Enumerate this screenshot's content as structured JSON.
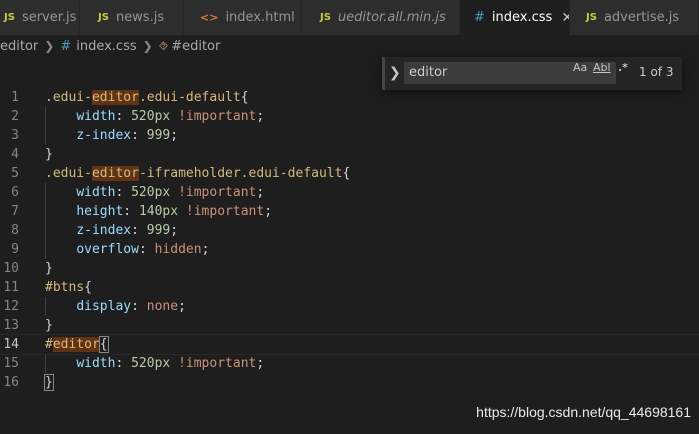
{
  "tabs": [
    {
      "icon": "JS",
      "label": "server.js",
      "type": "js"
    },
    {
      "icon": "JS",
      "label": "news.js",
      "type": "js"
    },
    {
      "icon": "<>",
      "label": "index.html",
      "type": "html"
    },
    {
      "icon": "JS",
      "label": "ueditor.all.min.js",
      "type": "js"
    },
    {
      "icon": "#",
      "label": "index.css",
      "type": "css",
      "close": "✕"
    },
    {
      "icon": "JS",
      "label": "advertise.js",
      "type": "js"
    }
  ],
  "breadcrumb": {
    "folder": "editor",
    "file": "index.css",
    "symbol": "#editor"
  },
  "find": {
    "query": "editor",
    "match_case": "Aa",
    "whole_word": "Abl",
    "regex": ".*",
    "result": "1 of 3"
  },
  "code_lines": [
    {
      "n": "1",
      "parts": [
        [
          ".edui-",
          "sel"
        ],
        [
          "editor",
          "selhl"
        ],
        [
          ".edui-default",
          "sel"
        ],
        [
          "{",
          "pun"
        ]
      ]
    },
    {
      "n": "2",
      "parts": [
        [
          "    ",
          "pun"
        ],
        [
          "width",
          "prop"
        ],
        [
          ": ",
          "pun"
        ],
        [
          "520px",
          "num"
        ],
        [
          " ",
          "pun"
        ],
        [
          "!important",
          "val"
        ],
        [
          ";",
          "pun"
        ]
      ]
    },
    {
      "n": "3",
      "parts": [
        [
          "    ",
          "pun"
        ],
        [
          "z-index",
          "prop"
        ],
        [
          ": ",
          "pun"
        ],
        [
          "999",
          "num"
        ],
        [
          ";",
          "pun"
        ]
      ]
    },
    {
      "n": "4",
      "parts": [
        [
          "}",
          "pun"
        ]
      ]
    },
    {
      "n": "5",
      "parts": [
        [
          ".edui-",
          "sel"
        ],
        [
          "editor",
          "selhl"
        ],
        [
          "-iframeholder.edui-default",
          "sel"
        ],
        [
          "{",
          "pun"
        ]
      ]
    },
    {
      "n": "6",
      "parts": [
        [
          "    ",
          "pun"
        ],
        [
          "width",
          "prop"
        ],
        [
          ": ",
          "pun"
        ],
        [
          "520px",
          "num"
        ],
        [
          " ",
          "pun"
        ],
        [
          "!important",
          "val"
        ],
        [
          ";",
          "pun"
        ]
      ]
    },
    {
      "n": "7",
      "parts": [
        [
          "    ",
          "pun"
        ],
        [
          "height",
          "prop"
        ],
        [
          ": ",
          "pun"
        ],
        [
          "140px",
          "num"
        ],
        [
          " ",
          "pun"
        ],
        [
          "!important",
          "val"
        ],
        [
          ";",
          "pun"
        ]
      ]
    },
    {
      "n": "8",
      "parts": [
        [
          "    ",
          "pun"
        ],
        [
          "z-index",
          "prop"
        ],
        [
          ": ",
          "pun"
        ],
        [
          "999",
          "num"
        ],
        [
          ";",
          "pun"
        ]
      ]
    },
    {
      "n": "9",
      "parts": [
        [
          "    ",
          "pun"
        ],
        [
          "overflow",
          "prop"
        ],
        [
          ": ",
          "pun"
        ],
        [
          "hidden",
          "val"
        ],
        [
          ";",
          "pun"
        ]
      ]
    },
    {
      "n": "10",
      "parts": [
        [
          "}",
          "pun"
        ]
      ]
    },
    {
      "n": "11",
      "parts": [
        [
          "#btns",
          "sel"
        ],
        [
          "{",
          "pun"
        ]
      ]
    },
    {
      "n": "12",
      "parts": [
        [
          "    ",
          "pun"
        ],
        [
          "display",
          "prop"
        ],
        [
          ": ",
          "pun"
        ],
        [
          "none",
          "val"
        ],
        [
          ";",
          "pun"
        ]
      ]
    },
    {
      "n": "13",
      "parts": [
        [
          "}",
          "pun"
        ]
      ]
    },
    {
      "n": "14",
      "current": true,
      "parts": [
        [
          "#",
          "sel"
        ],
        [
          "editor",
          "selhl"
        ],
        [
          "{",
          "bracket"
        ]
      ]
    },
    {
      "n": "15",
      "parts": [
        [
          "    ",
          "pun"
        ],
        [
          "width",
          "prop"
        ],
        [
          ": ",
          "pun"
        ],
        [
          "520px",
          "num"
        ],
        [
          " ",
          "pun"
        ],
        [
          "!important",
          "val"
        ],
        [
          ";",
          "pun"
        ]
      ]
    },
    {
      "n": "16",
      "parts": [
        [
          "}",
          "bracket"
        ]
      ]
    }
  ],
  "watermark": "https://blog.csdn.net/qq_44698161",
  "colors": {
    "background": "#1e1e1e",
    "selector": "#d7ba7d",
    "property": "#9cdcfe",
    "number": "#b5cea8",
    "value": "#ce9178",
    "find_highlight": "#613214"
  }
}
